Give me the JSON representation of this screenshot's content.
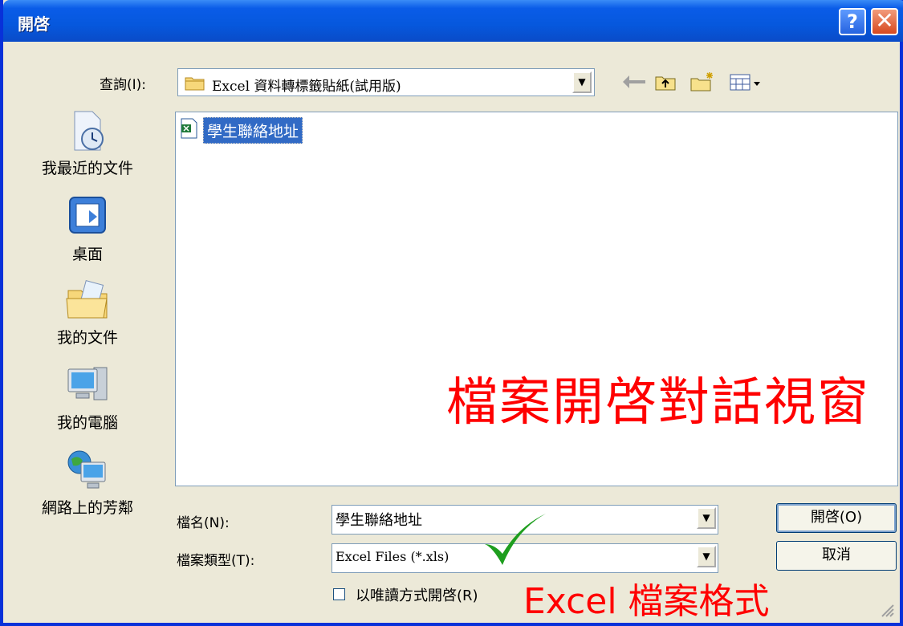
{
  "window": {
    "title": "開啓"
  },
  "titlebar_buttons": {
    "help": "?",
    "close": "✕"
  },
  "look_in": {
    "label": "查詢(I):",
    "value": "Excel 資料轉標籤貼紙(試用版)"
  },
  "toolbar": {
    "back_icon": "back-arrow-icon",
    "up_icon": "up-one-level-icon",
    "new_folder_icon": "create-new-folder-icon",
    "views_icon": "views-menu-icon"
  },
  "places": [
    {
      "label": "我最近的文件",
      "icon": "recent-documents-icon"
    },
    {
      "label": "桌面",
      "icon": "desktop-icon"
    },
    {
      "label": "我的文件",
      "icon": "my-documents-icon"
    },
    {
      "label": "我的電腦",
      "icon": "my-computer-icon"
    },
    {
      "label": "網路上的芳鄰",
      "icon": "network-places-icon"
    }
  ],
  "files": [
    {
      "name": "學生聯絡地址",
      "icon": "excel-file-icon",
      "selected": true
    }
  ],
  "annotations": {
    "dialog": "檔案開啓對話視窗",
    "format": "Excel 檔案格式"
  },
  "filename": {
    "label": "檔名(N):",
    "value": "學生聯絡地址"
  },
  "filetype": {
    "label": "檔案類型(T):",
    "value": "Excel Files (*.xls)"
  },
  "readonly": {
    "label": "以唯讀方式開啓(R)",
    "checked": false
  },
  "buttons": {
    "open": "開啓(O)",
    "cancel": "取消"
  },
  "colors": {
    "titlebar": "#0a5ce8",
    "selection": "#316ac5",
    "annotation": "#ff0000",
    "checkmark": "#1e9e1e"
  }
}
